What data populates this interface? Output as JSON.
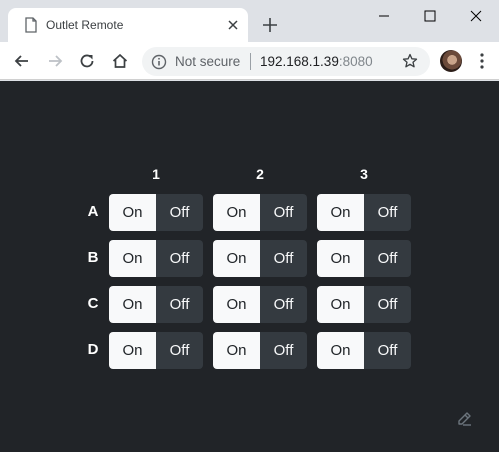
{
  "browser": {
    "tab_title": "Outlet Remote",
    "security_label": "Not secure",
    "url_host": "192.168.1.39",
    "url_port": ":8080"
  },
  "grid": {
    "columns": [
      "1",
      "2",
      "3"
    ],
    "rows": [
      "A",
      "B",
      "C",
      "D"
    ],
    "on_label": "On",
    "off_label": "Off"
  },
  "icons": {
    "tab": "page-icon",
    "close": "close-icon",
    "new_tab": "plus-icon",
    "back": "arrow-left-icon",
    "forward": "arrow-right-icon",
    "reload": "reload-icon",
    "home": "home-icon",
    "info": "info-icon",
    "bookmark": "star-icon",
    "menu": "kebab-menu-icon",
    "corner": "pencil-icon"
  },
  "colors": {
    "page_bg": "#212428",
    "on_bg": "#f8f9fa",
    "off_bg": "#343a40"
  }
}
